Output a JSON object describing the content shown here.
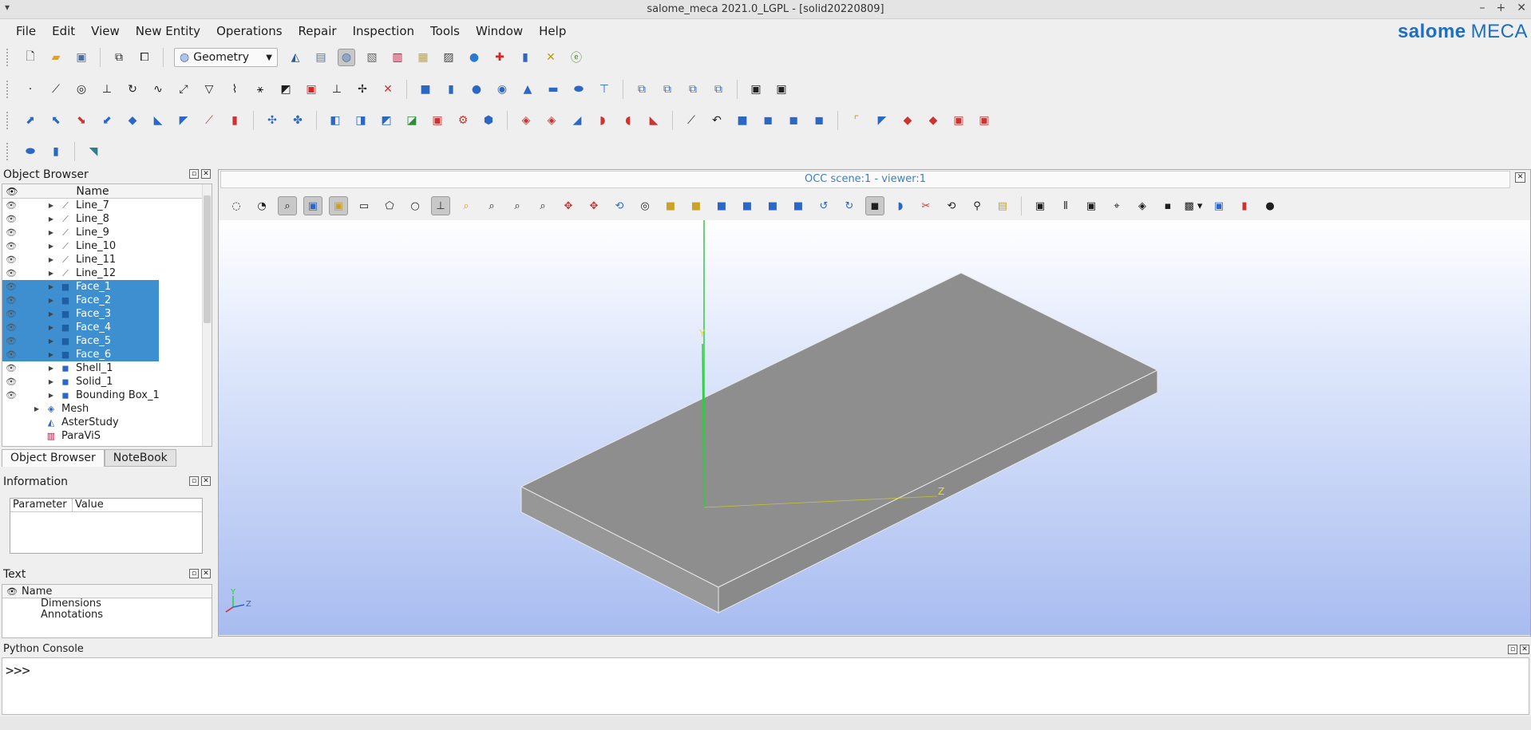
{
  "window": {
    "title": "salome_meca 2021.0_LGPL - [solid20220809]"
  },
  "menu": [
    "File",
    "Edit",
    "View",
    "New Entity",
    "Operations",
    "Repair",
    "Inspection",
    "Tools",
    "Window",
    "Help"
  ],
  "logo": {
    "brand": "salome",
    "product": "MECA"
  },
  "module_combo": {
    "value": "Geometry",
    "icon": "geometry-icon"
  },
  "object_browser": {
    "title": "Object Browser",
    "column": "Name",
    "items": [
      {
        "label": "Line_7",
        "icon": "line-icon",
        "selected": false
      },
      {
        "label": "Line_8",
        "icon": "line-icon",
        "selected": false
      },
      {
        "label": "Line_9",
        "icon": "line-icon",
        "selected": false
      },
      {
        "label": "Line_10",
        "icon": "line-icon",
        "selected": false
      },
      {
        "label": "Line_11",
        "icon": "line-icon",
        "selected": false
      },
      {
        "label": "Line_12",
        "icon": "line-icon",
        "selected": false
      },
      {
        "label": "Face_1",
        "icon": "face-icon",
        "selected": true
      },
      {
        "label": "Face_2",
        "icon": "face-icon",
        "selected": true
      },
      {
        "label": "Face_3",
        "icon": "face-icon",
        "selected": true
      },
      {
        "label": "Face_4",
        "icon": "face-icon",
        "selected": true
      },
      {
        "label": "Face_5",
        "icon": "face-icon",
        "selected": true
      },
      {
        "label": "Face_6",
        "icon": "face-icon",
        "selected": true
      },
      {
        "label": "Shell_1",
        "icon": "shell-icon",
        "selected": false
      },
      {
        "label": "Solid_1",
        "icon": "solid-icon",
        "selected": false
      },
      {
        "label": "Bounding Box_1",
        "icon": "box-icon",
        "selected": false
      },
      {
        "label": "Mesh",
        "icon": "mesh-icon",
        "selected": false
      },
      {
        "label": "AsterStudy",
        "icon": "asterstudy-icon",
        "selected": false
      },
      {
        "label": "ParaViS",
        "icon": "paravis-icon",
        "selected": false
      }
    ],
    "tabs": [
      "Object Browser",
      "NoteBook"
    ]
  },
  "information": {
    "title": "Information",
    "columns": [
      "Parameter",
      "Value"
    ]
  },
  "text_panel": {
    "title": "Text",
    "column": "Name",
    "items": [
      "Dimensions",
      "Annotations"
    ]
  },
  "viewer": {
    "title": "OCC scene:1 - viewer:1",
    "axis_labels": {
      "y": "Y",
      "z": "Z",
      "tri_y": "Y",
      "tri_z": "Z"
    }
  },
  "python_console": {
    "title": "Python Console",
    "prompt": ">>>"
  },
  "colors": {
    "selection": "#3d8fd0",
    "solid": "#8c8c8c",
    "accent": "#1e6fc0"
  }
}
